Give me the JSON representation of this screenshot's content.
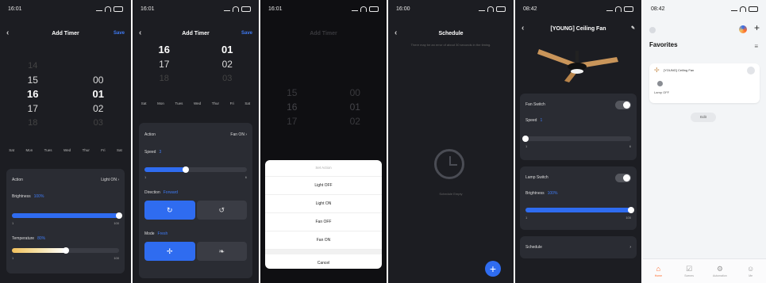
{
  "screens": [
    {
      "time": "16:01",
      "title": "Add Timer",
      "save": "Save",
      "hours": [
        "14",
        "15",
        "16",
        "17",
        "18"
      ],
      "minutes": [
        "",
        "00",
        "01",
        "02",
        "03"
      ],
      "days": [
        "Sat",
        "Mon",
        "Tues",
        "Wed",
        "Thur",
        "Fri",
        "Sat"
      ],
      "action_label": "Action",
      "action_value": "Light ON",
      "brightness_label": "Brightness",
      "brightness_value": "100%",
      "temperature_label": "Temperature",
      "temperature_value": "80%",
      "range_min": "1",
      "range_max": "100",
      "brightness_level": 1.0,
      "temperature_level": 0.5
    },
    {
      "time": "16:01",
      "title": "Add Timer",
      "save": "Save",
      "hours": [
        "16",
        "17",
        "18"
      ],
      "minutes": [
        "01",
        "02",
        "03"
      ],
      "days": [
        "Sat",
        "Mon",
        "Tues",
        "Wed",
        "Thur",
        "Fri",
        "Sat"
      ],
      "action_label": "Action",
      "action_value": "Fan ON",
      "speed_label": "Speed",
      "speed_value": "3",
      "speed_min": "1",
      "speed_max": "6",
      "direction_label": "Direction",
      "direction_value": "Forward",
      "mode_label": "Mode",
      "mode_value": "Fresh"
    },
    {
      "time": "16:01",
      "title": "Add Timer",
      "hours": [
        "15",
        "16",
        "17"
      ],
      "minutes": [
        "00",
        "01",
        "02"
      ],
      "sheet_title": "Set Action",
      "options": [
        "Light OFF",
        "Light ON",
        "Fan OFF",
        "Fan ON"
      ],
      "cancel": "Cancel"
    },
    {
      "time": "16:00",
      "title": "Schedule",
      "hint": "There may be an error of about 30 seconds in the timing.",
      "empty": "Schedule Empty",
      "fab": "+"
    },
    {
      "time": "08:42",
      "title": "[YOUNG] Ceiling Fan",
      "fan_switch": "Fan Switch",
      "speed_label": "Speed",
      "speed_value": "1",
      "speed_min": "1",
      "speed_max": "6",
      "lamp_switch": "Lamp Switch",
      "brightness_label": "Brightness",
      "brightness_value": "100%",
      "brightness_min": "1",
      "brightness_max": "100",
      "schedule": "Schedule"
    },
    {
      "time": "08:42",
      "favorites": "Favorites",
      "device_name": "[YOUNG] Ceiling Fan",
      "device_status": "Lamp OFF",
      "edit": "Edit",
      "tabs": [
        "Home",
        "Scenes",
        "Automation",
        "Me"
      ]
    }
  ],
  "colors": {
    "accent": "#2f6cf0",
    "tab_active": "#ff6a2a"
  }
}
